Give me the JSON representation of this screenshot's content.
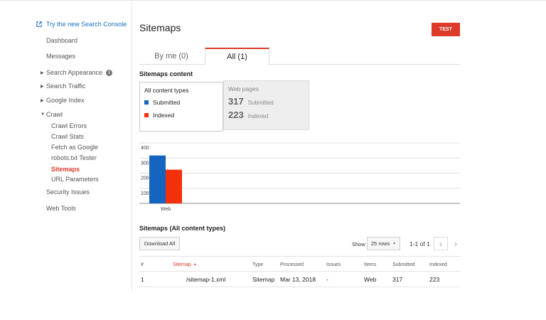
{
  "sidebar": {
    "try_link": "Try the new Search Console",
    "items": [
      {
        "label": "Dashboard"
      },
      {
        "label": "Messages"
      },
      {
        "label": "Search Appearance"
      },
      {
        "label": "Search Traffic"
      },
      {
        "label": "Google Index"
      },
      {
        "label": "Crawl"
      },
      {
        "label": "Security Issues"
      },
      {
        "label": "Web Tools"
      }
    ],
    "crawl_sub": [
      "Crawl Errors",
      "Crawl Stats",
      "Fetch as Google",
      "robots.txt Tester",
      "Sitemaps",
      "URL Parameters"
    ]
  },
  "header": {
    "title": "Sitemaps",
    "test_label": "TEST"
  },
  "tabs": [
    {
      "label": "By me (0)"
    },
    {
      "label": "All (1)"
    }
  ],
  "content": {
    "section_title": "Sitemaps content",
    "types_header": "All content types",
    "legend_submitted": "Submitted",
    "legend_indexed": "Indexed",
    "web_header": "Web pages",
    "web_submitted_num": "317",
    "web_submitted_lbl": "Submitted",
    "web_indexed_num": "223",
    "web_indexed_lbl": "Indexed"
  },
  "colors": {
    "submitted": "#1565c0",
    "indexed": "#f4300a",
    "accent": "#dd3a2b",
    "link": "#1a6ec7"
  },
  "chart_data": {
    "type": "bar",
    "categories": [
      "Web"
    ],
    "series": [
      {
        "name": "Submitted",
        "values": [
          317
        ]
      },
      {
        "name": "Indexed",
        "values": [
          223
        ]
      }
    ],
    "yticks": [
      "100",
      "200",
      "300",
      "400"
    ],
    "ylim": [
      0,
      400
    ],
    "grid": true
  },
  "table": {
    "title": "Sitemaps (All content types)",
    "download_label": "Download All",
    "show_label": "Show",
    "rows_select": "25 rows",
    "pager_text": "1-1 of 1",
    "columns": [
      "#",
      "Sitemap",
      "Type",
      "Processed",
      "Issues",
      "Items",
      "Submitted",
      "Indexed"
    ],
    "rows": [
      [
        "1",
        "/sitemap-1.xml",
        "Sitemap",
        "Mar 13, 2018",
        "-",
        "Web",
        "317",
        "223"
      ]
    ]
  }
}
